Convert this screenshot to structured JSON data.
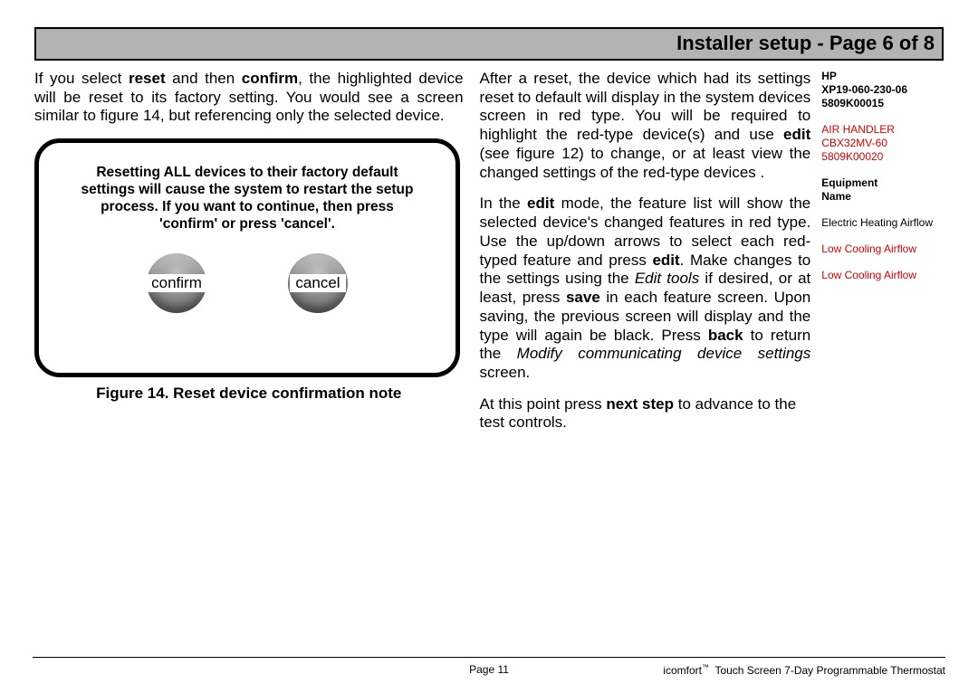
{
  "header": {
    "title": "Installer setup - Page 6 of 8"
  },
  "left": {
    "intro_html": "If you select <b>reset</b> and then <b>confirm</b>, the highlighted device will be reset to its factory setting. You would see a screen similar to figure 14, but referencing only the selected device.",
    "dialog_message": "Resetting ALL devices to their factory default settings will cause the system to restart the setup process. If you want to continue, then press 'confirm' or press 'cancel'.",
    "confirm_label": "confirm",
    "cancel_label": "cancel",
    "figure_caption": "Figure 14. Reset device confirmation note"
  },
  "mid": {
    "p1_html": "After a reset, the device which had its settings reset to default will display in the system devices screen in red type. You will be required to highlight the red-type device(s) and use <b>edit</b> (see figure 12) to change, or at least view the changed settings of the red-type devices .",
    "p2_html": "In the <b>edit</b> mode, the feature list will show the selected device's changed features in red type. Use the up/down arrows to select each red-typed feature and press <b>edit</b>. Make changes to the settings using the <i>Edit tools</i> if desired, or at least, press <b>save</b> in each feature screen. Upon saving, the previous screen will display and the type will again be black. Press <b>back</b> to return the <i>Modify communicating device settings</i> screen.",
    "p3_html": "At this point press <b>next step</b> to advance to the test controls."
  },
  "side": {
    "hp_label": "HP",
    "hp_model": "XP19-060-230-06",
    "hp_serial": "5809K00015",
    "ah_label": "AIR HANDLER",
    "ah_model": "CBX32MV-60",
    "ah_serial": "5809K00020",
    "equip_heading_1": "Equipment",
    "equip_heading_2": "Name",
    "feat1": "Electric Heating Airflow",
    "feat2": "Low Cooling Airflow",
    "feat3": "Low Cooling Airflow"
  },
  "footer": {
    "page": "Page 11",
    "brand": "icomfort",
    "tm": "™",
    "tagline": "Touch Screen 7-Day Programmable Thermostat"
  }
}
